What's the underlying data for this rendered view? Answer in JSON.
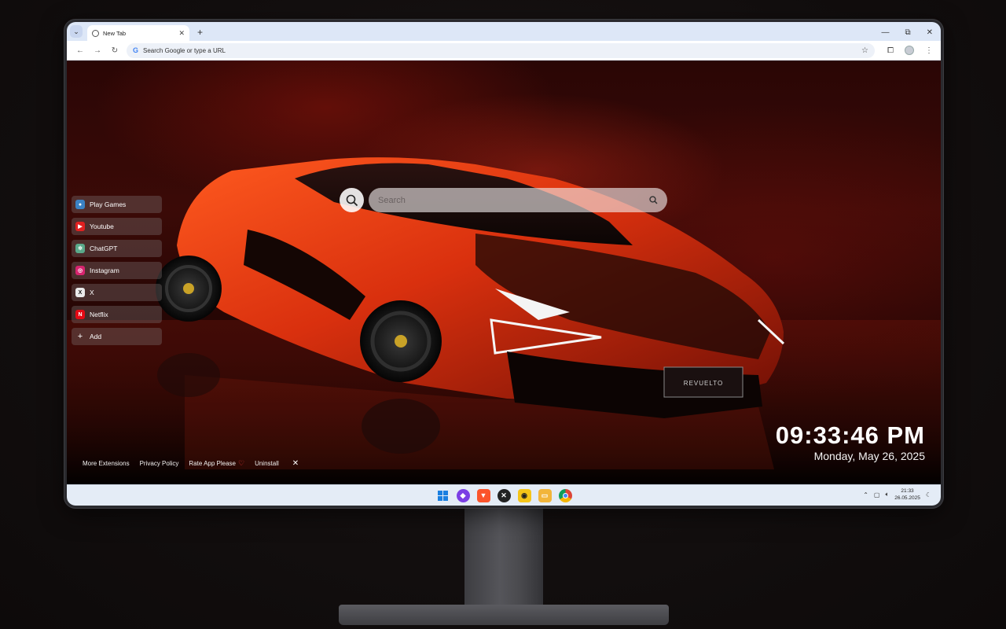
{
  "browser": {
    "tab_title": "New Tab",
    "address_placeholder": "Search Google or type a URL"
  },
  "page": {
    "search_placeholder": "Search",
    "shortcuts": [
      {
        "label": "Play Games",
        "icon": "games-icon",
        "color": "#3b82c4"
      },
      {
        "label": "Youtube",
        "icon": "youtube-icon",
        "color": "#e02020"
      },
      {
        "label": "ChatGPT",
        "icon": "chatgpt-icon",
        "color": "#5aa98a"
      },
      {
        "label": "Instagram",
        "icon": "instagram-icon",
        "color": "#d6246e"
      },
      {
        "label": "X",
        "icon": "x-icon",
        "color": "#111111"
      },
      {
        "label": "Netflix",
        "icon": "netflix-icon",
        "color": "#e50914"
      },
      {
        "label": "Add",
        "icon": "plus-icon",
        "color": "transparent"
      }
    ],
    "footer": {
      "more_extensions": "More Extensions",
      "privacy_policy": "Privacy Policy",
      "rate_app": "Rate App Please",
      "uninstall": "Uninstall"
    },
    "clock": {
      "time": "09:33:46 PM",
      "date": "Monday, May 26, 2025"
    },
    "plate_text": "REVUELTO"
  },
  "taskbar": {
    "apps": [
      {
        "name": "start-icon",
        "color": "#1a7fe0"
      },
      {
        "name": "app-purple-icon",
        "color": "#7b3fe4"
      },
      {
        "name": "brave-icon",
        "color": "#fb542b"
      },
      {
        "name": "xbox-icon",
        "color": "#222222"
      },
      {
        "name": "game-app-icon",
        "color": "#f5c518"
      },
      {
        "name": "folder-icon",
        "color": "#f2b53a"
      },
      {
        "name": "chrome-icon",
        "color": "#db4437"
      }
    ],
    "time": "21:33",
    "date": "26.05.2025"
  }
}
